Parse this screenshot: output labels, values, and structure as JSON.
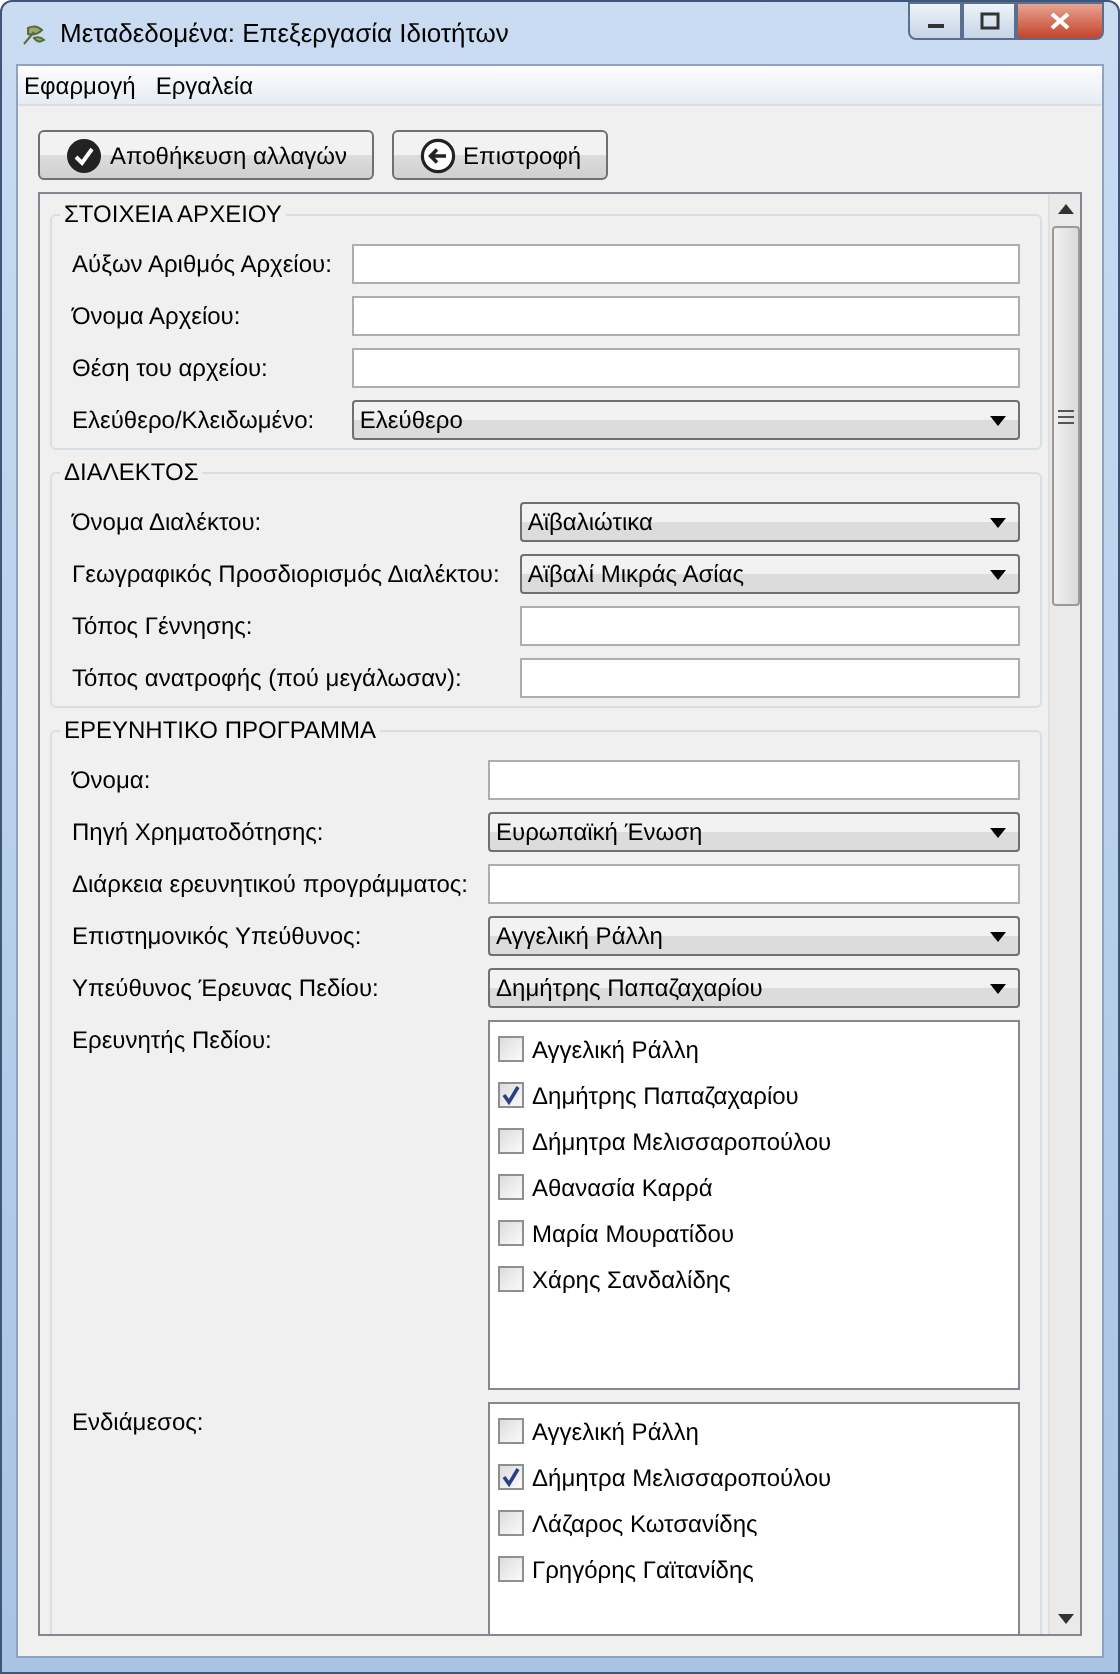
{
  "window": {
    "title": "Μεταδεδομένα: Επεξεργασία Ιδιοτήτων"
  },
  "menu": [
    "Εφαρμογή",
    "Εργαλεία"
  ],
  "toolbar": [
    {
      "label": "Αποθήκευση αλλαγών",
      "kind": "save"
    },
    {
      "label": "Επιστροφή",
      "kind": "back"
    }
  ],
  "sections": [
    {
      "title": "ΣΤΟΙΧΕΙΑ ΑΡΧΕΙΟΥ",
      "fields": [
        {
          "label": "Αύξων Αριθμός Αρχείου:",
          "kind": "text"
        },
        {
          "label": "Όνομα Αρχείου:",
          "kind": "text"
        },
        {
          "label": "Θέση του αρχείου:",
          "kind": "text"
        },
        {
          "label": "Ελεύθερο/Κλειδωμένο:",
          "kind": "combo",
          "value": "Ελεύθερο"
        }
      ]
    },
    {
      "title": "ΔΙΑΛΕΚΤΟΣ",
      "fields": [
        {
          "label": "Όνομα Διαλέκτου:",
          "kind": "combo",
          "value": "Αϊβαλιώτικα"
        },
        {
          "label": "Γεωγραφικός Προσδιορισμός Διαλέκτου:",
          "kind": "combo",
          "value": "Αϊβαλί Μικράς Ασίας"
        },
        {
          "label": "Τόπος Γέννησης:",
          "kind": "text"
        },
        {
          "label": "Τόπος ανατροφής (πού μεγάλωσαν):",
          "kind": "text"
        }
      ]
    },
    {
      "title": "ΕΡΕΥΝΗΤΙΚΟ ΠΡΟΓΡΑΜΜΑ",
      "fields": [
        {
          "label": "Όνομα:",
          "kind": "text"
        },
        {
          "label": "Πηγή Χρηματοδότησης:",
          "kind": "combo",
          "value": "Ευρωπαϊκή Ένωση"
        },
        {
          "label": "Διάρκεια ερευνητικού προγράμματος:",
          "kind": "text"
        },
        {
          "label": "Επιστημονικός Υπεύθυνος:",
          "kind": "combo",
          "value": "Αγγελική Ράλλη"
        },
        {
          "label": "Υπεύθυνος Έρευνας Πεδίου:",
          "kind": "combo",
          "value": "Δημήτρης Παπαζαχαρίου"
        },
        {
          "label": "Ερευνητής Πεδίου:",
          "kind": "checklist",
          "items": [
            {
              "label": "Αγγελική Ράλλη",
              "checked": false
            },
            {
              "label": "Δημήτρης Παπαζαχαρίου",
              "checked": true
            },
            {
              "label": "Δήμητρα Μελισσαροπούλου",
              "checked": false
            },
            {
              "label": "Αθανασία Καρρά",
              "checked": false
            },
            {
              "label": "Μαρία Μουρατίδου",
              "checked": false
            },
            {
              "label": "Χάρης Σανδαλίδης",
              "checked": false
            }
          ]
        },
        {
          "label": "Ενδιάμεσος:",
          "kind": "checklist",
          "items": [
            {
              "label": "Αγγελική Ράλλη",
              "checked": false
            },
            {
              "label": "Δήμητρα Μελισσαροπούλου",
              "checked": true
            },
            {
              "label": "Λάζαρος Κωτσανίδης",
              "checked": false
            },
            {
              "label": "Γρηγόρης Γαϊτανίδης",
              "checked": false
            }
          ]
        }
      ]
    }
  ]
}
